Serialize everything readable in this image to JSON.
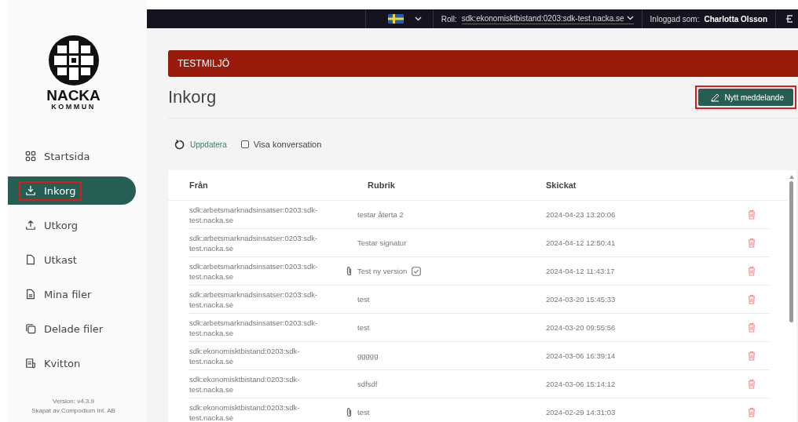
{
  "logo": {
    "name": "NACKA",
    "subtitle": "KOMMUN"
  },
  "nav": [
    {
      "label": "Startsida",
      "kind": "grid",
      "selected": false,
      "highlighted": false
    },
    {
      "label": "Inkorg",
      "kind": "inbox",
      "selected": true,
      "highlighted": true
    },
    {
      "label": "Utkorg",
      "kind": "outbox",
      "selected": false,
      "highlighted": false
    },
    {
      "label": "Utkast",
      "kind": "file",
      "selected": false,
      "highlighted": false
    },
    {
      "label": "Mina filer",
      "kind": "doc",
      "selected": false,
      "highlighted": false
    },
    {
      "label": "Delade filer",
      "kind": "copy",
      "selected": false,
      "highlighted": false
    },
    {
      "label": "Kvitton",
      "kind": "receipt",
      "selected": false,
      "highlighted": false
    }
  ],
  "footer": [
    "Version: v4.3.9",
    "Skapat av Compodium Int. AB"
  ],
  "topbar": {
    "role_label": "Roll:",
    "role_value": "sdk:ekonomisktbistand:0203:sdk-test.nacka.se",
    "user_label": "Inloggad som:",
    "user_name": "Charlotta Olsson"
  },
  "banner": "TESTMILJÖ",
  "title": "Inkorg",
  "new_button": {
    "label": "Nytt meddelande",
    "highlighted": true
  },
  "toolbar": {
    "refresh": "Uppdatera",
    "show_conversation": {
      "label": "Visa konversation",
      "checked": false
    }
  },
  "table": {
    "columns": [
      "Från",
      "Rubrik",
      "Skickat"
    ],
    "rows": [
      {
        "from": "sdk:arbetsmarknadsinsatser:0203:sdk-test.nacka.se",
        "subject": "testar återta 2",
        "sent": "2024-04-23 13:20:06",
        "attachment": false,
        "receipt": false
      },
      {
        "from": "sdk:arbetsmarknadsinsatser:0203:sdk-test.nacka.se",
        "subject": "Testar signatur",
        "sent": "2024-04-12 12:50:41",
        "attachment": false,
        "receipt": false
      },
      {
        "from": "sdk:arbetsmarknadsinsatser:0203:sdk-test.nacka.se",
        "subject": "Test ny version",
        "sent": "2024-04-12 11:43:17",
        "attachment": true,
        "receipt": true
      },
      {
        "from": "sdk:arbetsmarknadsinsatser:0203:sdk-test.nacka.se",
        "subject": "test",
        "sent": "2024-03-20 15:45:33",
        "attachment": false,
        "receipt": false
      },
      {
        "from": "sdk:arbetsmarknadsinsatser:0203:sdk-test.nacka.se",
        "subject": "test",
        "sent": "2024-03-20 09:55:56",
        "attachment": false,
        "receipt": false
      },
      {
        "from": "sdk:ekonomisktbistand:0203:sdk-test.nacka.se",
        "subject": "ggggg",
        "sent": "2024-03-06 16:39:14",
        "attachment": false,
        "receipt": false
      },
      {
        "from": "sdk:ekonomisktbistand:0203:sdk-test.nacka.se",
        "subject": "sdfsdf",
        "sent": "2024-03-06 15:14:12",
        "attachment": false,
        "receipt": false
      },
      {
        "from": "sdk:ekonomisktbistand:0203:sdk-test.nacka.se",
        "subject": "test",
        "sent": "2024-02-29 14:31:03",
        "attachment": true,
        "receipt": false
      }
    ]
  }
}
